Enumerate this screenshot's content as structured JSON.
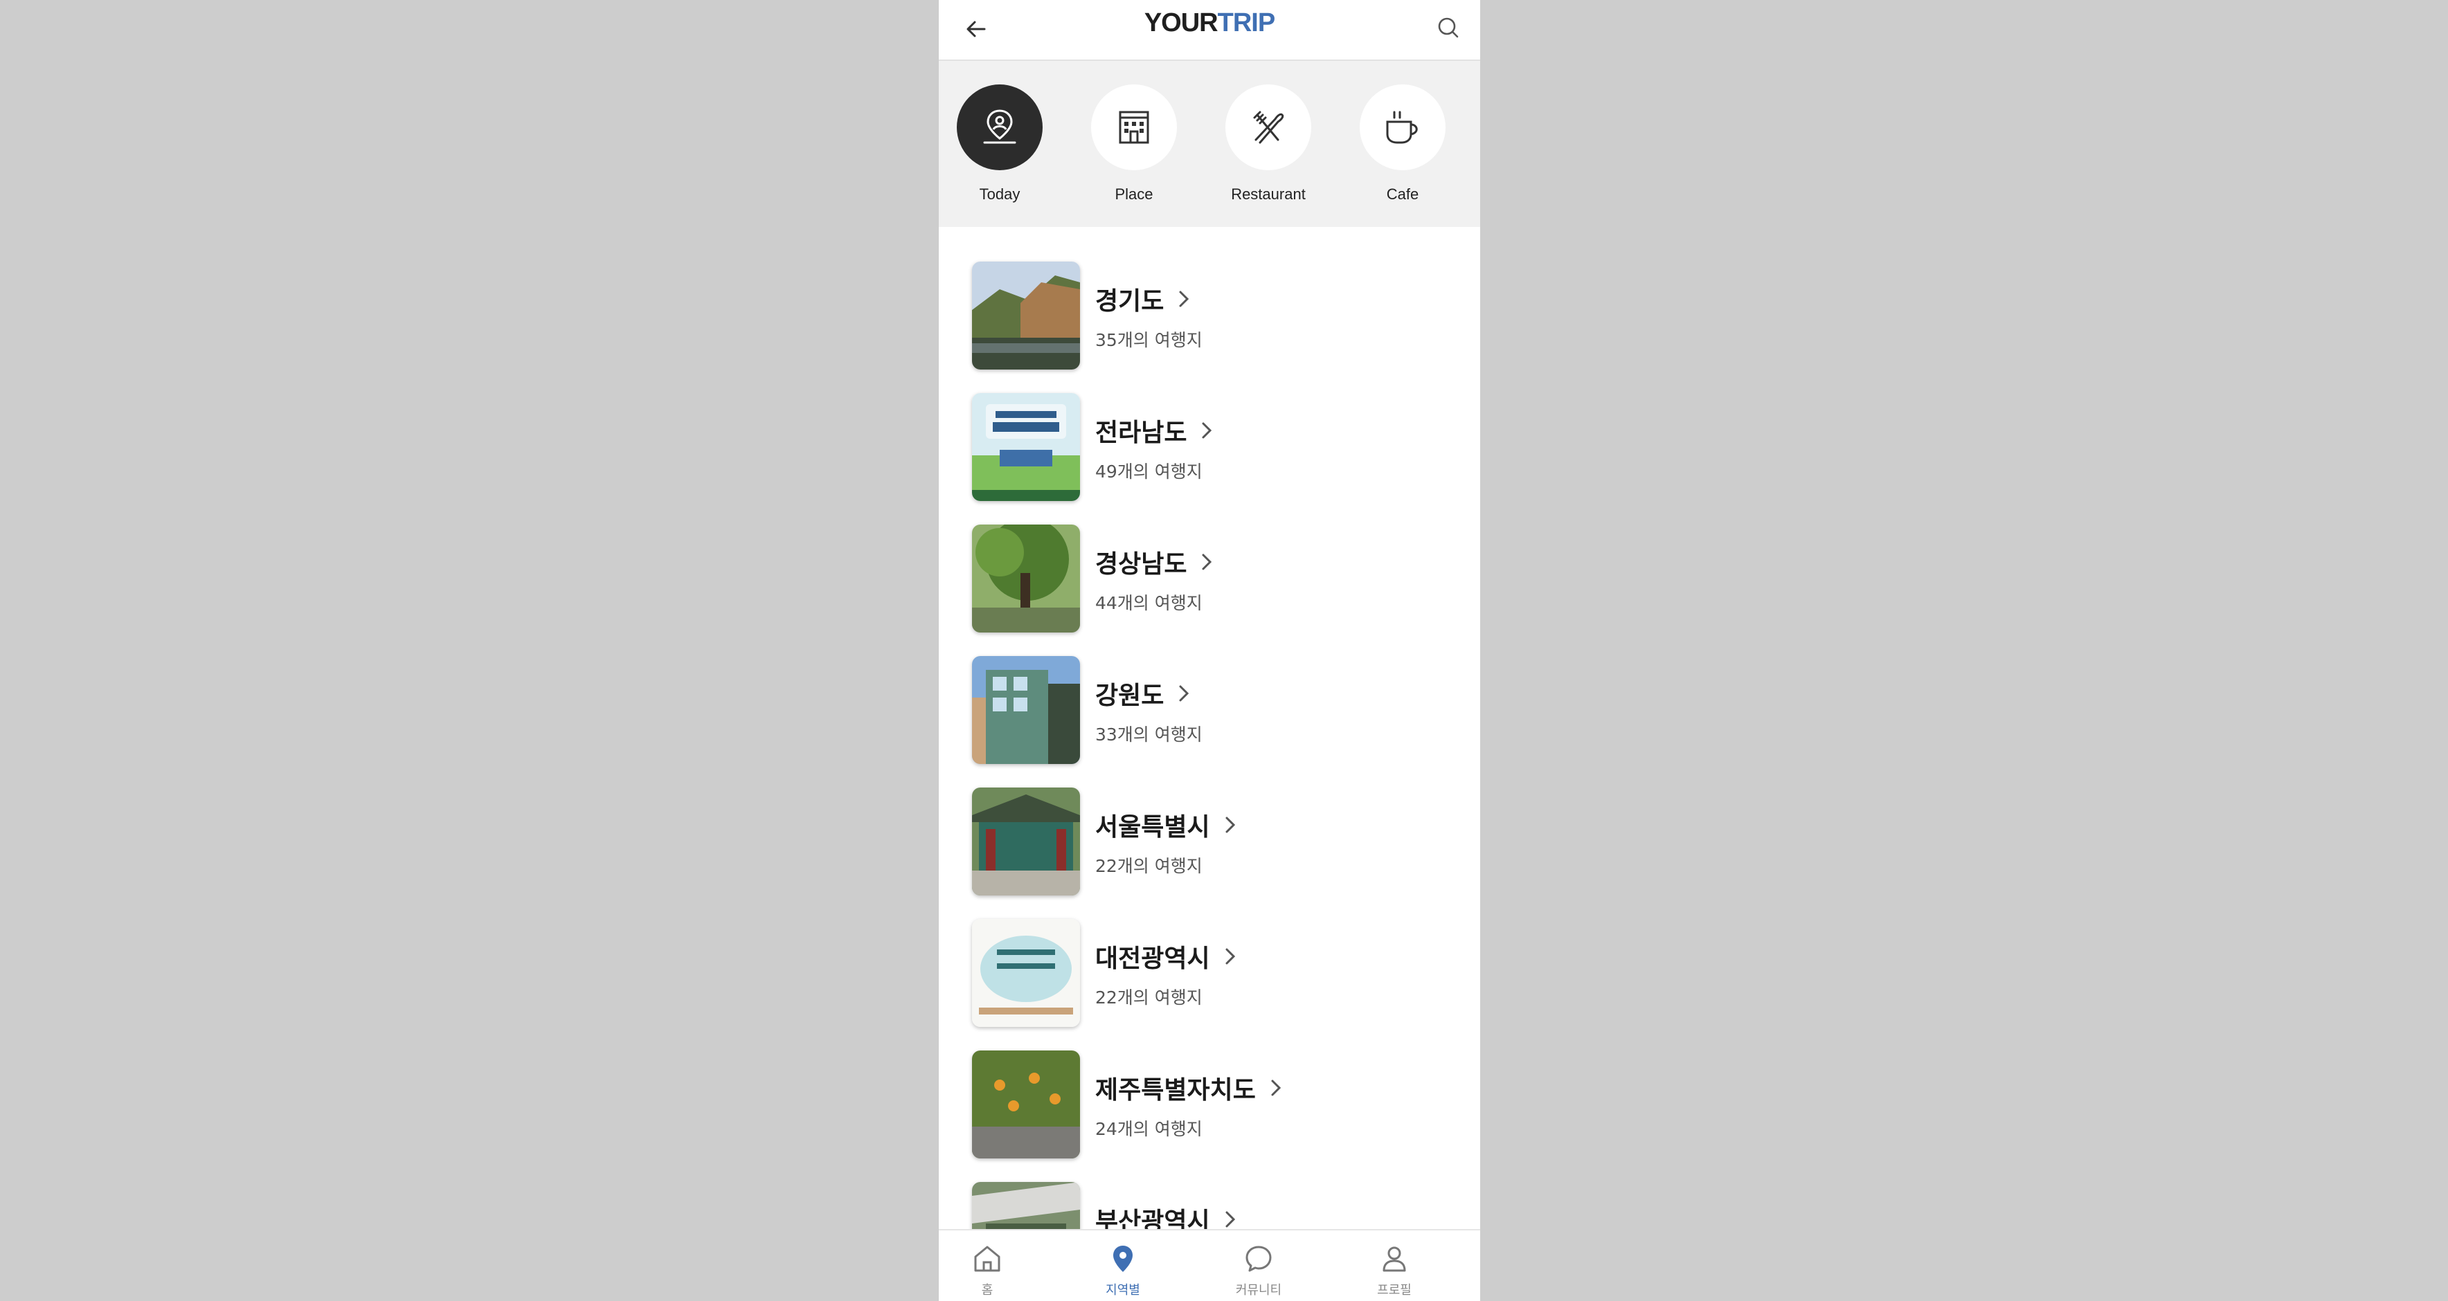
{
  "app": {
    "logo_part1": "YOUR",
    "logo_part2": "TRIP",
    "accent": "#3f6fb3"
  },
  "categories": [
    {
      "label": "Today",
      "icon": "map-pin-person-icon",
      "active": true
    },
    {
      "label": "Place",
      "icon": "building-icon",
      "active": false
    },
    {
      "label": "Restaurant",
      "icon": "fork-knife-icon",
      "active": false
    },
    {
      "label": "Cafe",
      "icon": "coffee-cup-icon",
      "active": false
    }
  ],
  "regions": [
    {
      "name": "경기도",
      "count": "35개의 여행지"
    },
    {
      "name": "전라남도",
      "count": "49개의 여행지"
    },
    {
      "name": "경상남도",
      "count": "44개의 여행지"
    },
    {
      "name": "강원도",
      "count": "33개의 여행지"
    },
    {
      "name": "서울특별시",
      "count": "22개의 여행지"
    },
    {
      "name": "대전광역시",
      "count": "22개의 여행지"
    },
    {
      "name": "제주특별자치도",
      "count": "24개의 여행지"
    },
    {
      "name": "부산광역시",
      "count": ""
    }
  ],
  "bottom_nav": [
    {
      "label": "홈",
      "icon": "home-icon",
      "active": false
    },
    {
      "label": "지역별",
      "icon": "location-pin-icon",
      "active": true
    },
    {
      "label": "커뮤니티",
      "icon": "chat-bubble-icon",
      "active": false
    },
    {
      "label": "프로필",
      "icon": "person-icon",
      "active": false
    }
  ]
}
